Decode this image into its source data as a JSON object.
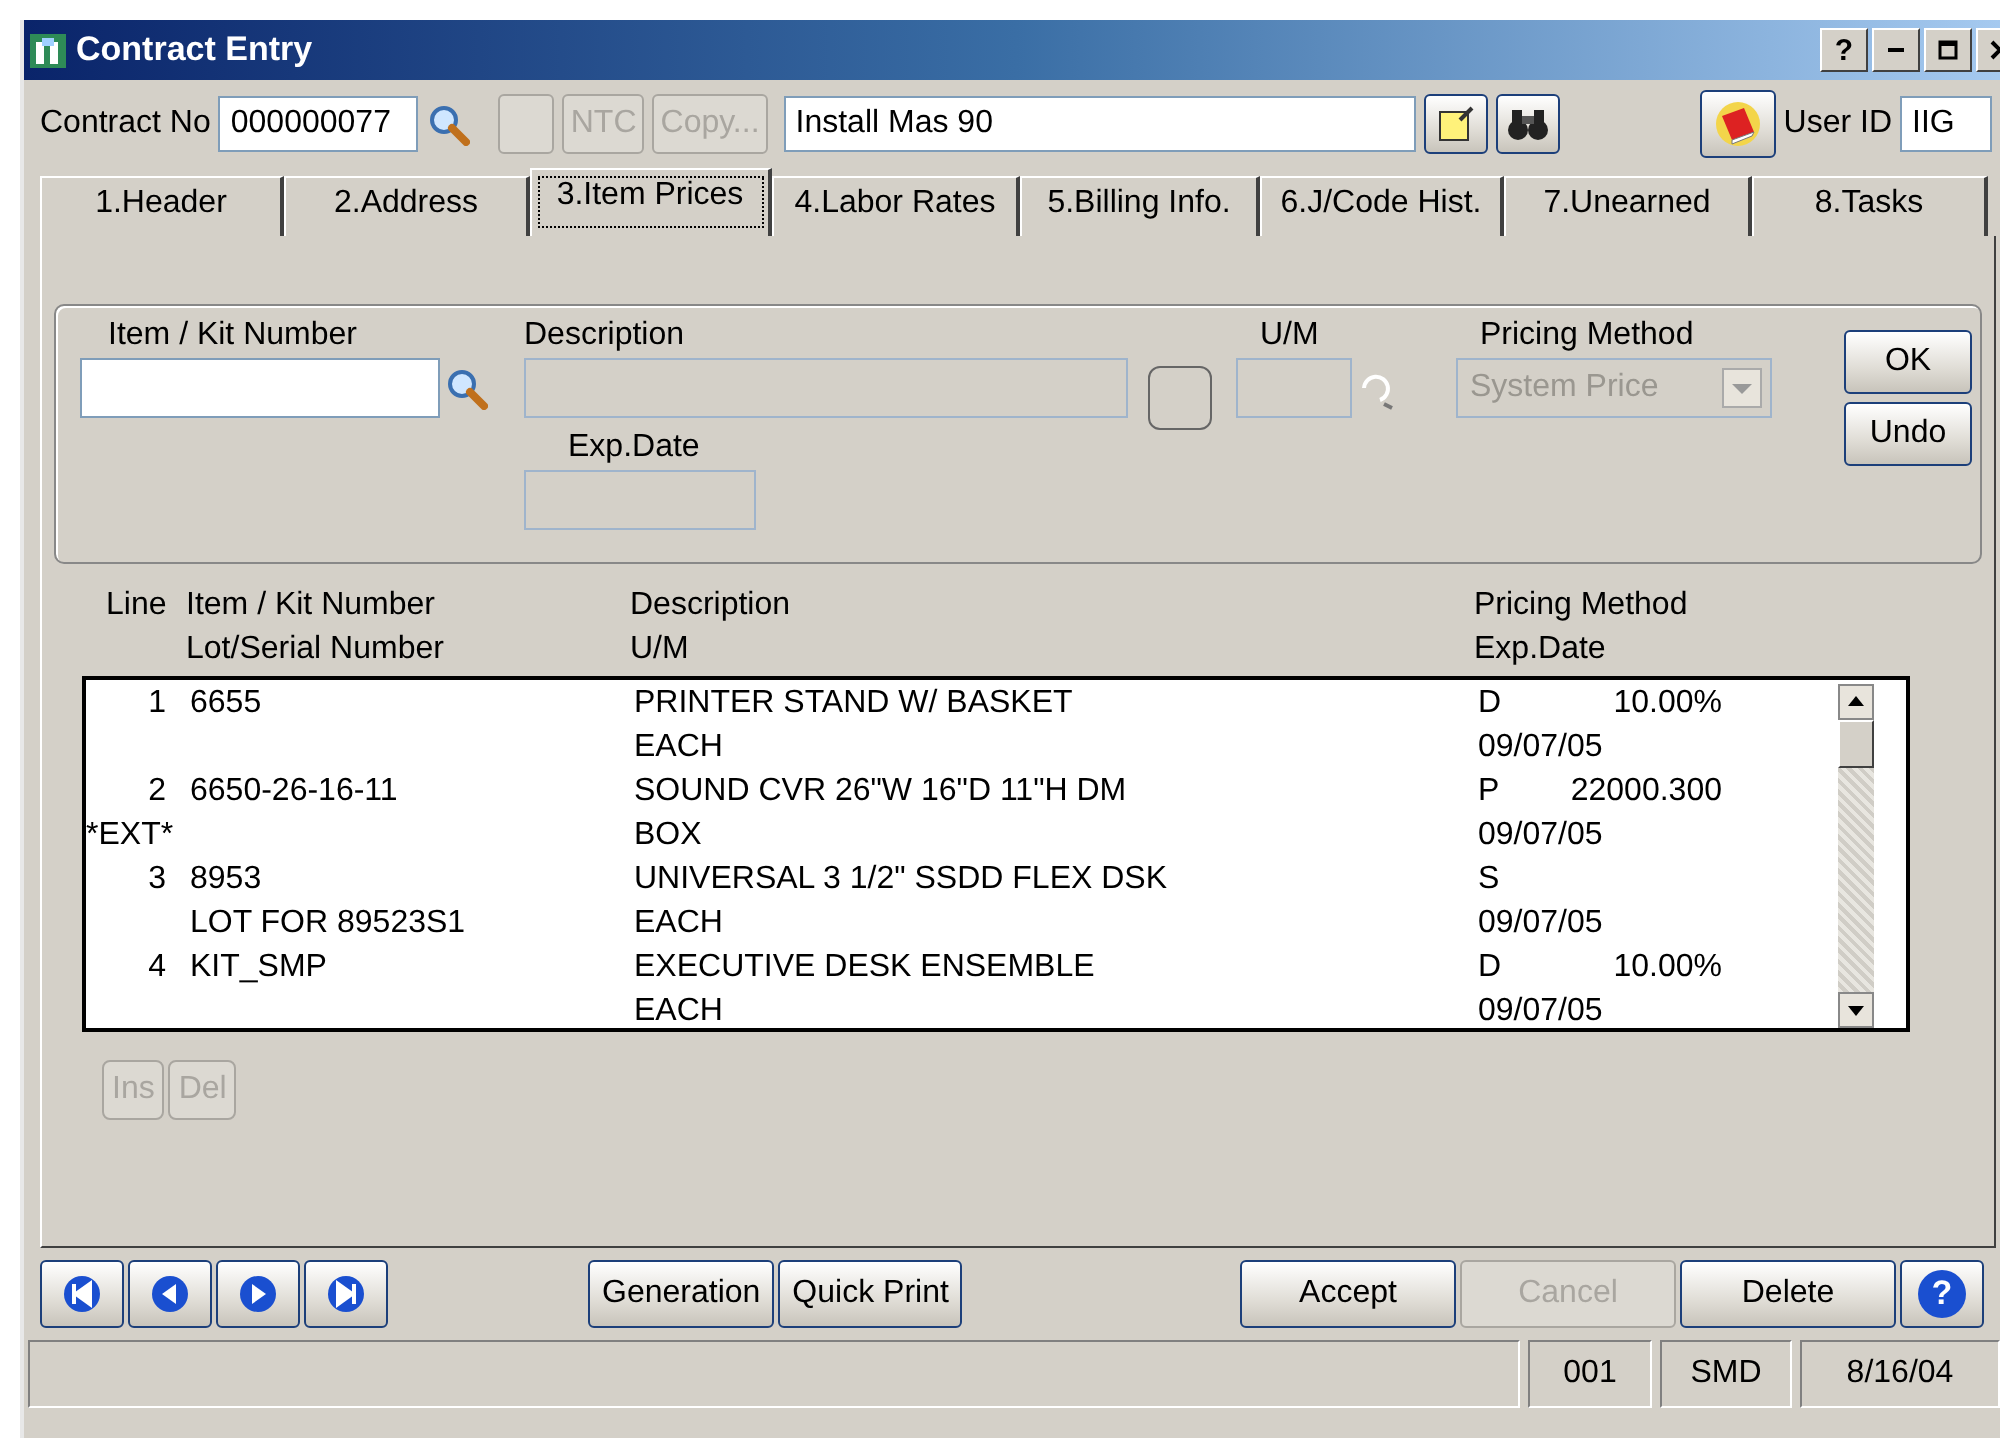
{
  "window": {
    "title": "Contract Entry",
    "help_glyph": "?"
  },
  "toolbar": {
    "contract_label": "Contract No",
    "contract_no": "000000077",
    "buttons": [
      {
        "label": "NTC",
        "disabled": true
      },
      {
        "label": "Copy...",
        "disabled": true
      }
    ],
    "description": "Install Mas 90",
    "user_label": "User ID",
    "user_id": "IIG"
  },
  "tabs": [
    {
      "label": "1.Header",
      "selected": false
    },
    {
      "label": "2.Address",
      "selected": false
    },
    {
      "label": "3.Item Prices",
      "selected": true
    },
    {
      "label": "4.Labor Rates",
      "selected": false
    },
    {
      "label": "5.Billing Info.",
      "selected": false
    },
    {
      "label": "6.J/Code Hist.",
      "selected": false
    },
    {
      "label": "7.Unearned",
      "selected": false
    },
    {
      "label": "8.Tasks",
      "selected": false
    }
  ],
  "entry": {
    "item_label": "Item / Kit Number",
    "description_label": "Description",
    "um_label": "U/M",
    "pricing_label": "Pricing Method",
    "pricing_value": "System Price",
    "exp_label": "Exp.Date",
    "buttons": [
      {
        "label": "OK",
        "disabled": false
      },
      {
        "label": "Undo",
        "disabled": false
      }
    ]
  },
  "grid": {
    "columns": [
      [
        "Line"
      ],
      [
        "Item / Kit Number",
        "Lot/Serial Number"
      ],
      [
        "Description",
        "U/M"
      ],
      [
        "Pricing Method",
        "Exp.Date"
      ]
    ],
    "rows": [
      {
        "line": "1",
        "item": "6655",
        "description": "PRINTER STAND W/ BASKET",
        "pricing_code": "D",
        "pricing_value": "10.00%",
        "um": "EACH",
        "exp_date": "09/07/05"
      },
      {
        "line": "2",
        "item": "6650-26-16-11",
        "description": "SOUND CVR 26\"W 16\"D 11\"H DM",
        "pricing_code": "P",
        "pricing_value": "22000.300",
        "flag": "*EXT*",
        "um": "BOX",
        "exp_date": "09/07/05"
      },
      {
        "line": "3",
        "item": "8953",
        "description": "UNIVERSAL 3 1/2\" SSDD FLEX DSK",
        "pricing_code": "S",
        "lot": "LOT FOR 89523S1",
        "um": "EACH",
        "exp_date": "09/07/05"
      },
      {
        "line": "4",
        "item": "KIT_SMP",
        "description": "EXECUTIVE DESK ENSEMBLE",
        "pricing_code": "D",
        "pricing_value": "10.00%",
        "um": "EACH",
        "exp_date": "09/07/05"
      }
    ],
    "buttons": [
      {
        "label": "Ins",
        "disabled": true
      },
      {
        "label": "Del",
        "disabled": true
      }
    ]
  },
  "footer": {
    "middle_buttons": [
      {
        "label": "Generation",
        "disabled": false
      },
      {
        "label": "Quick Print",
        "disabled": false
      }
    ],
    "help_glyph": "?",
    "right_buttons": [
      {
        "label": "Accept",
        "disabled": false
      },
      {
        "label": "Cancel",
        "disabled": true
      },
      {
        "label": "Delete",
        "disabled": false
      }
    ]
  },
  "status_bar": {
    "company": "001",
    "user": "SMD",
    "date": "8/16/04"
  }
}
